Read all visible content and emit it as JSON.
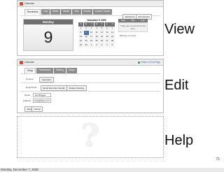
{
  "view_panel": {
    "title": "Calendar",
    "tabs": [
      "Reminders",
      "Day",
      "Week",
      "Month",
      "Year",
      "Events",
      "Export / Import"
    ],
    "active_tab": 0,
    "day_name": "Monday",
    "day_number": "9",
    "calendar": {
      "caption": "November 9, 2009",
      "weekdays": [
        "S",
        "M",
        "T",
        "W",
        "T",
        "F",
        "S"
      ],
      "rows": [
        [
          "1",
          "2",
          "3",
          "4",
          "5",
          "6",
          "7"
        ],
        [
          "8",
          "9",
          "10",
          "11",
          "12",
          "13",
          "14"
        ],
        [
          "15",
          "16",
          "17",
          "18",
          "19",
          "20",
          "21"
        ],
        [
          "22",
          "23",
          "24",
          "25",
          "26",
          "27",
          "28"
        ],
        [
          "29",
          "30",
          "1",
          "2",
          "3",
          "4",
          "5"
        ]
      ],
      "selected": "9"
    },
    "buttons": [
      "Add Event",
      "Permissions"
    ],
    "side_tabs": [
      "Date",
      "Title",
      "Type"
    ],
    "empty_text": "There are no events at this time.",
    "birthday_text": "Birthday 0 results"
  },
  "edit_panel": {
    "title": "Calendar",
    "return_link": "Return to Full Page",
    "tabs": [
      "Setup",
      "Permissions",
      "Sharing",
      "Scope"
    ],
    "active_tab": 0,
    "content_label": "Content",
    "content_button": "Calendars",
    "email_label": "Email Prefs",
    "email_buttons": [
      "Email Reminder Emails",
      "Display Settings"
    ],
    "name_label": "Name",
    "name_value": "Joe Blogger",
    "address_label": "Address",
    "address_value": "blog@blog.com",
    "save_label": "Save",
    "cancel_label": "Cancel"
  },
  "help_panel": {
    "symbol": "?"
  },
  "labels": {
    "view": "View",
    "edit": "Edit",
    "help": "Help"
  },
  "page_number": "71",
  "footer_date": "Monday, December 7, 2009"
}
